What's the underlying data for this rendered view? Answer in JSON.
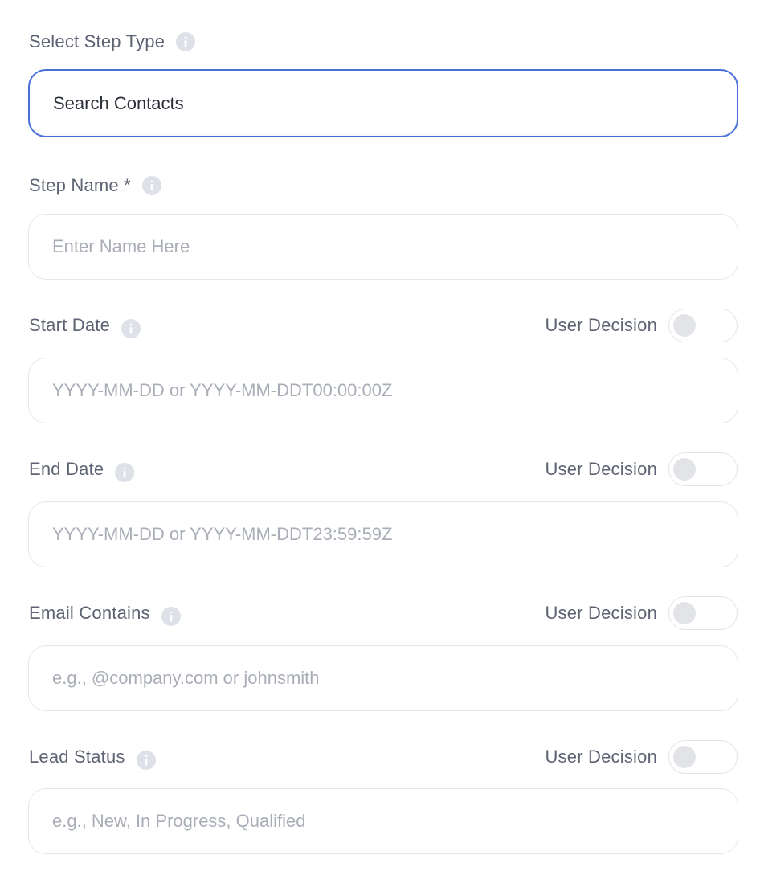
{
  "step_type": {
    "label": "Select Step Type",
    "value": "Search Contacts"
  },
  "step_name": {
    "label": "Step Name *",
    "placeholder": "Enter Name Here",
    "value": ""
  },
  "start_date": {
    "label": "Start Date",
    "decision_label": "User Decision",
    "decision_on": false,
    "placeholder": "YYYY-MM-DD or YYYY-MM-DDT00:00:00Z",
    "value": ""
  },
  "end_date": {
    "label": "End Date",
    "decision_label": "User Decision",
    "decision_on": false,
    "placeholder": "YYYY-MM-DD or YYYY-MM-DDT23:59:59Z",
    "value": ""
  },
  "email_contains": {
    "label": "Email Contains",
    "decision_label": "User Decision",
    "decision_on": false,
    "placeholder": "e.g., @company.com or johnsmith",
    "value": ""
  },
  "lead_status": {
    "label": "Lead Status",
    "decision_label": "User Decision",
    "decision_on": false,
    "placeholder": "e.g., New, In Progress, Qualified",
    "value": ""
  },
  "colors": {
    "selected_border": "#4a6fd6",
    "label_text": "#5d6373",
    "placeholder_text": "#a9adb7",
    "field_border": "#e5e7ec",
    "toggle_off_knob": "#e3e4e8"
  },
  "icons": {
    "info": "info-icon"
  }
}
